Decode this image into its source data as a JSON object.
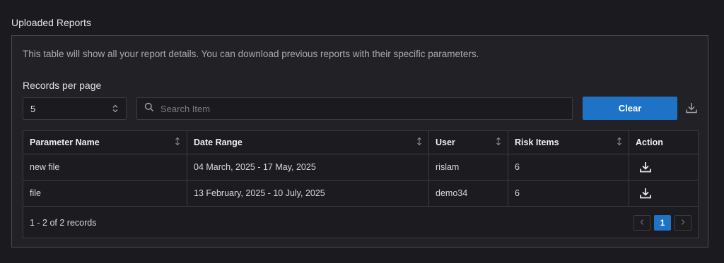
{
  "section": {
    "title": "Uploaded Reports"
  },
  "panel": {
    "description": "This table will show all your report details. You can download previous reports with their specific parameters.",
    "records_per_page_label": "Records per page",
    "records_per_page_value": "5",
    "search_placeholder": "Search Item",
    "clear_label": "Clear"
  },
  "table": {
    "headers": [
      "Parameter Name",
      "Date Range",
      "User",
      "Risk Items",
      "Action"
    ],
    "rows": [
      {
        "parameter_name": "new file",
        "date_range": "04 March, 2025 - 17 May, 2025",
        "user": "rislam",
        "risk_items": "6"
      },
      {
        "parameter_name": "file",
        "date_range": "13 February, 2025 - 10 July, 2025",
        "user": "demo34",
        "risk_items": "6"
      }
    ],
    "footer": {
      "records_text": "1 - 2 of 2 records",
      "current_page": "1"
    }
  },
  "icons": {
    "search": "search-icon",
    "select_arrows": "chevron-up-down-icon",
    "export": "download-icon",
    "sort": "sort-icon",
    "row_download": "download-icon",
    "prev": "chevron-left-icon",
    "next": "chevron-right-icon"
  },
  "colors": {
    "accent": "#1f73c7",
    "background": "#1b1b1f",
    "panel": "#222226"
  }
}
